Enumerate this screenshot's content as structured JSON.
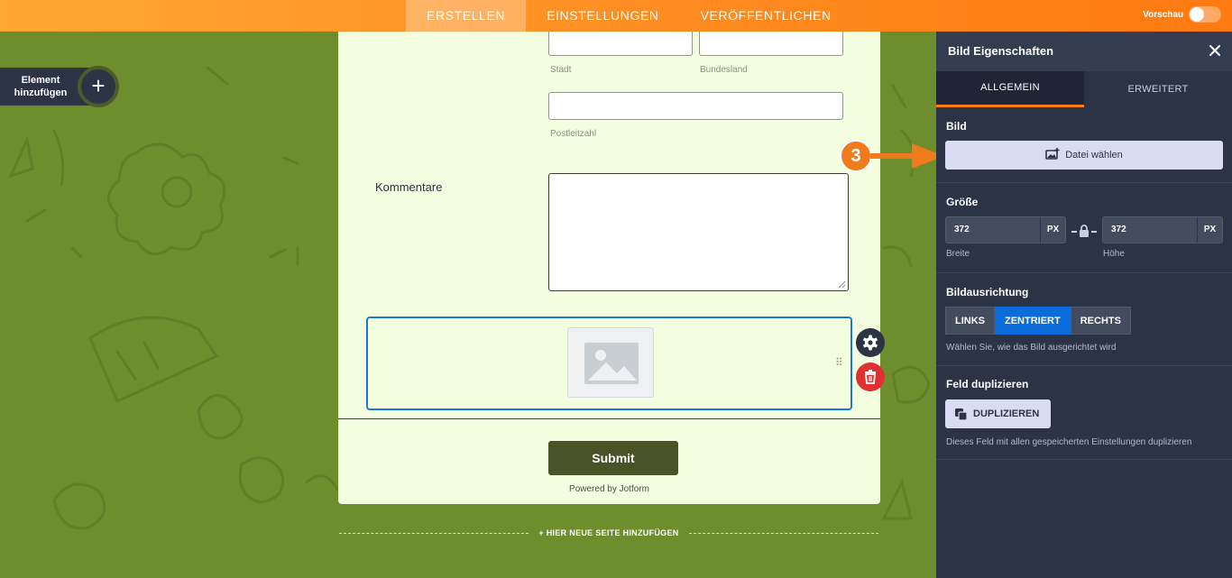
{
  "topbar": {
    "tabs": [
      {
        "label": "ERSTELLEN"
      },
      {
        "label": "EINSTELLUNGEN"
      },
      {
        "label": "VERÖFFENTLICHEN"
      }
    ],
    "preview_label": "Vorschau"
  },
  "canvas": {
    "add_element_line1": "Element",
    "add_element_line2": "hinzufügen",
    "add_new_page": "+ HIER NEUE SEITE HINZUFÜGEN"
  },
  "form": {
    "sublabels": {
      "city": "Stadt",
      "state": "Bundesland",
      "zip": "Postleitzahl"
    },
    "comments_label": "Kommentare",
    "submit_label": "Submit",
    "powered_by": "Powered by Jotform"
  },
  "annotation": {
    "step": "3"
  },
  "panel": {
    "title": "Bild Eigenschaften",
    "tabs": [
      {
        "label": "ALLGEMEIN"
      },
      {
        "label": "ERWEITERT"
      }
    ],
    "image": {
      "title": "Bild",
      "choose_file": "Datei wählen"
    },
    "size": {
      "title": "Größe",
      "width_value": "372",
      "height_value": "372",
      "unit": "PX",
      "width_label": "Breite",
      "height_label": "Höhe"
    },
    "alignment": {
      "title": "Bildausrichtung",
      "options": [
        "LINKS",
        "ZENTRIERT",
        "RECHTS"
      ],
      "hint": "Wählen Sie, wie das Bild ausgerichtet wird"
    },
    "duplicate": {
      "title": "Feld duplizieren",
      "button": "DUPLIZIEREN",
      "hint": "Dieses Feld mit allen gespeicherten Einstellungen duplizieren"
    }
  },
  "colors": {
    "brand_orange": "#ff8a1f",
    "canvas_green": "#6e8e2e",
    "panel_dark": "#2c3345",
    "selected_blue": "#0a6ddb",
    "delete_red": "#e0302f"
  }
}
